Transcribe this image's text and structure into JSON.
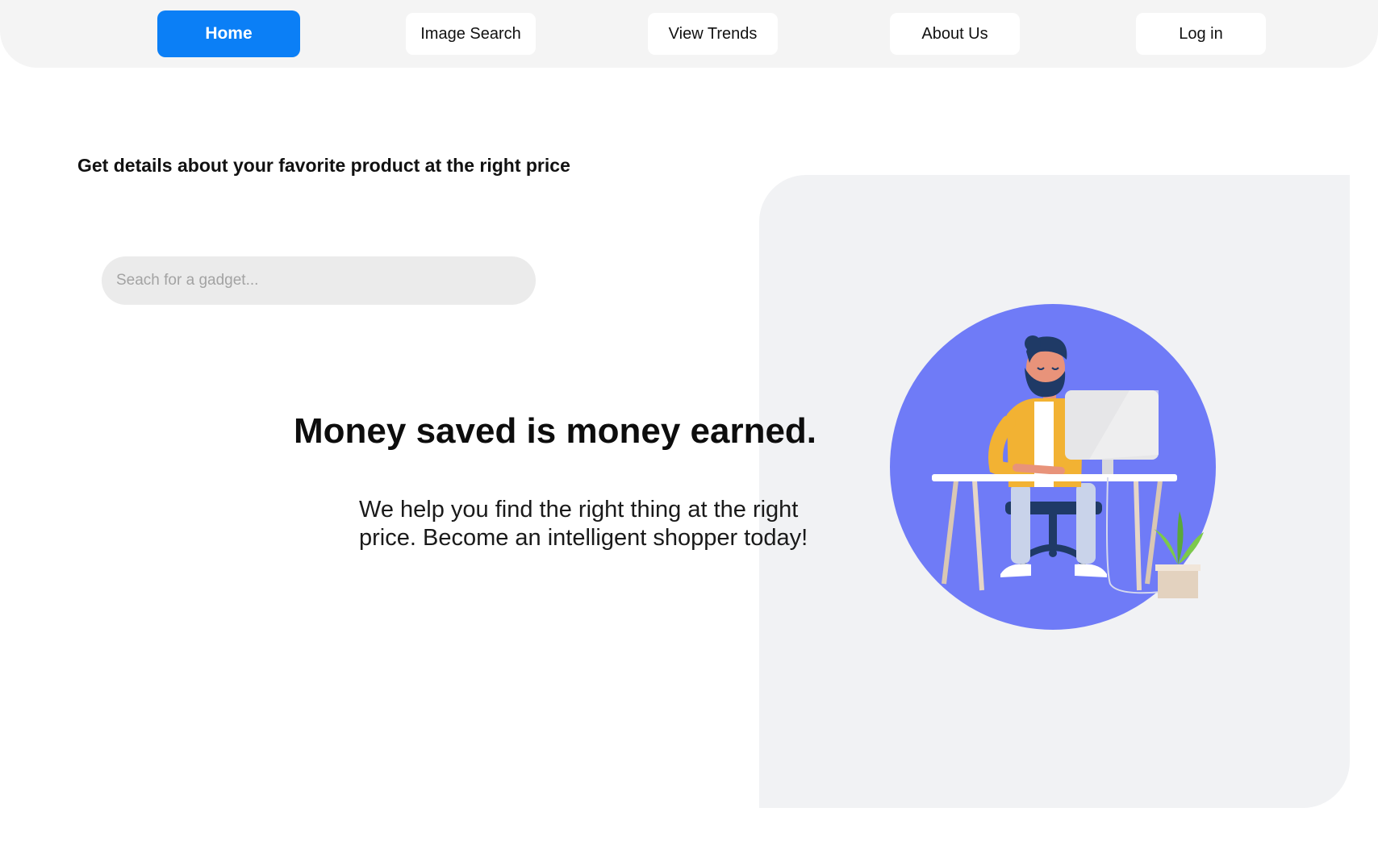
{
  "nav": {
    "items": [
      {
        "label": "Home",
        "active": true
      },
      {
        "label": "Image Search",
        "active": false
      },
      {
        "label": "View Trends",
        "active": false
      },
      {
        "label": "About Us",
        "active": false
      },
      {
        "label": "Log in",
        "active": false
      }
    ]
  },
  "hero": {
    "tagline": "Get details about your favorite product at the right price",
    "search": {
      "placeholder": "Seach for a gadget...",
      "value": ""
    },
    "headline": "Money saved is money earned.",
    "description_lines": [
      "We help you find the right thing at the right",
      "price. Become an intelligent shopper today!"
    ],
    "illustration": "person-at-desk-illustration"
  },
  "colors": {
    "accent": "#0b7ff6",
    "nav_background": "#f4f4f4",
    "panel_background": "#f1f2f4",
    "illustration_circle": "#6f7bf7",
    "search_background": "#ebebeb"
  }
}
